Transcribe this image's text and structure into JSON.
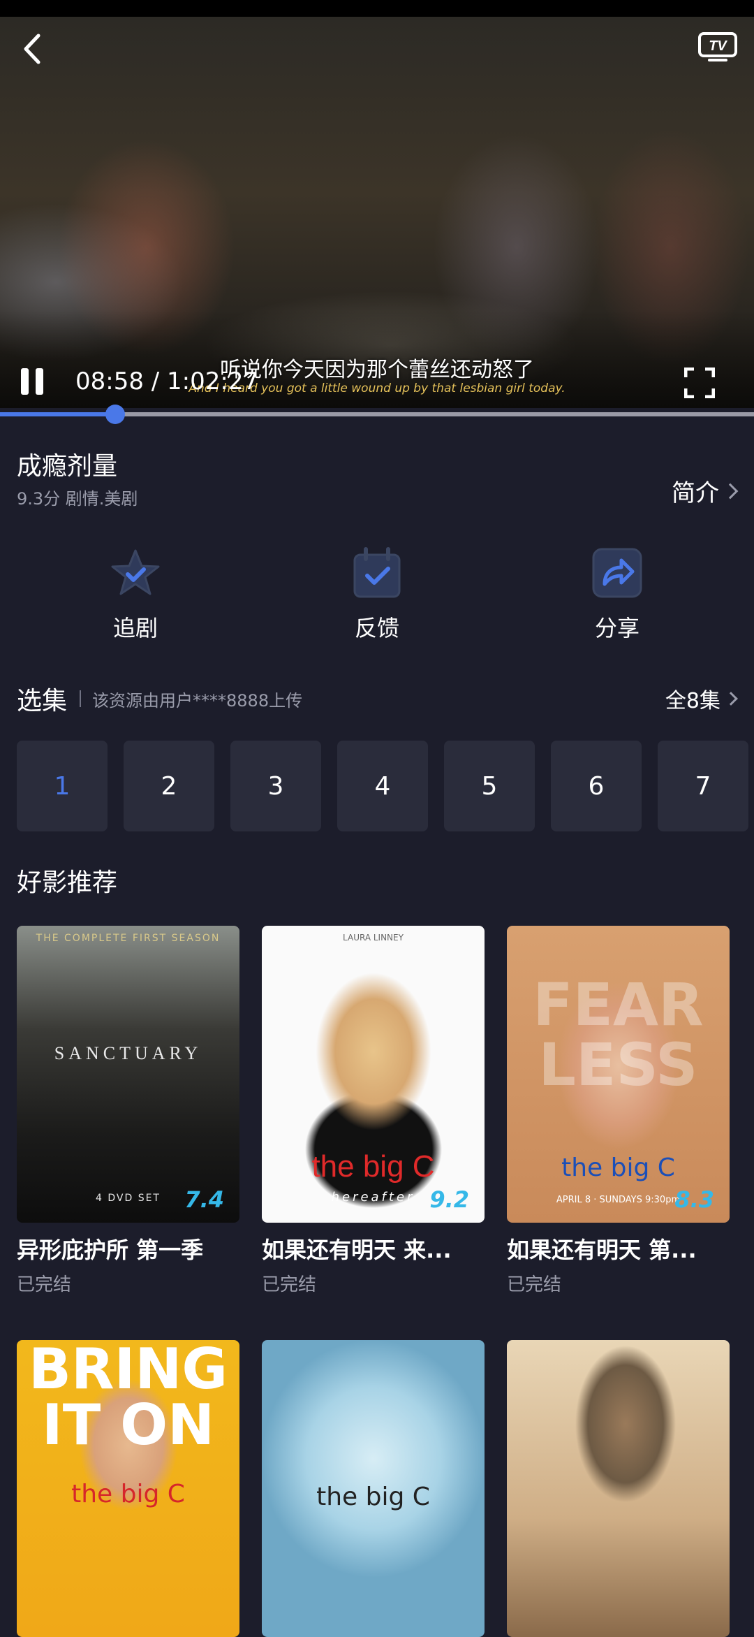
{
  "player": {
    "current_time": "08:58 / 1:02:27",
    "subtitle_cn": "听说你今天因为那个蕾丝还动怒了",
    "subtitle_en": "And I heard you got a little wound up by that lesbian girl today.",
    "tv_label": "TV",
    "progress_percent": 15.3
  },
  "show": {
    "title": "成瘾剂量",
    "meta": "9.3分  剧情.美剧",
    "intro_label": "简介"
  },
  "actions": [
    {
      "label": "追剧",
      "icon": "star-check-icon"
    },
    {
      "label": "反馈",
      "icon": "calendar-check-icon"
    },
    {
      "label": "分享",
      "icon": "share-arrow-icon"
    }
  ],
  "episodes": {
    "heading": "选集",
    "source_note": "该资源由用户****8888上传",
    "all_label": "全8集",
    "items": [
      "1",
      "2",
      "3",
      "4",
      "5",
      "6",
      "7"
    ],
    "active_index": 0
  },
  "recommend": {
    "heading": "好影推荐",
    "items": [
      {
        "name": "异形庇护所 第一季",
        "status": "已完结",
        "score": "7.4",
        "poster_text": "SANCTUARY",
        "poster_top": "THE COMPLETE FIRST SEASON",
        "poster_bottom": "4 DVD SET"
      },
      {
        "name": "如果还有明天 来...",
        "status": "已完结",
        "score": "9.2",
        "poster_text": "the big C",
        "poster_top": "LAURA LINNEY",
        "poster_bottom": "hereafter"
      },
      {
        "name": "如果还有明天 第...",
        "status": "已完结",
        "score": "8.3",
        "poster_text": "the big C",
        "poster_top": "FEAR LESS",
        "poster_bottom": "APRIL 8 · SUNDAYS 9:30pm"
      },
      {
        "name": "",
        "status": "",
        "score": "",
        "poster_text": "BRING IT ON",
        "poster_top": "",
        "poster_bottom": "the big C"
      },
      {
        "name": "",
        "status": "",
        "score": "",
        "poster_text": "the big C",
        "poster_top": "",
        "poster_bottom": ""
      },
      {
        "name": "",
        "status": "",
        "score": "",
        "poster_text": "",
        "poster_top": "",
        "poster_bottom": ""
      }
    ]
  }
}
